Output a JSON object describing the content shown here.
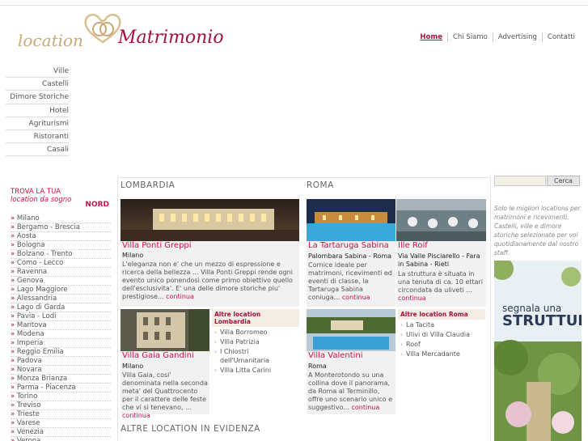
{
  "header": {
    "logo_word1": "location",
    "logo_word2": "Matrimonio",
    "nav": [
      "Home",
      "Chi Siamo",
      "Advertising",
      "Contatti"
    ]
  },
  "leftmenu": [
    "Ville",
    "Castelli",
    "Dimore Storiche",
    "Hotel",
    "Agriturismi",
    "Ristoranti",
    "Casali"
  ],
  "trova": {
    "line1": "TROVA LA TUA",
    "line2": "location da sogno",
    "area": "NORD"
  },
  "regions": [
    "Milano",
    "Bergamo - Brescia",
    "Aosta",
    "Bologna",
    "Bolzano - Trento",
    "Como - Lecco",
    "Ravenna",
    "Genova",
    "Lago Maggiore",
    "Alessandria",
    "Lago di Garda",
    "Pavia - Lodi",
    "Mantova",
    "Modena",
    "Imperia",
    "Reggio Emilia",
    "Padova",
    "Novara",
    "Monza Brianza",
    "Parma - Piacenza",
    "Torino",
    "Treviso",
    "Trieste",
    "Varese",
    "Venezia",
    "Verona"
  ],
  "region_prefix": "»",
  "sections": {
    "lombardia": "LOMBARDIA",
    "roma": "ROMA",
    "evidenza": "ALTRE LOCATION IN EVIDENZA"
  },
  "cards": {
    "ponti": {
      "title": "Villa Ponti Greppi",
      "city": "Milano",
      "desc": "L'eleganza non e' che un mezzo di espressione e ricerca della bellezza ... Villa Ponti Greppi rende ogni evento unico ponendosi come primo obiettivo quello dell'esclusivita'. E' una delle dimore storiche piu' prestigiose...",
      "more": "continua"
    },
    "tartaruga": {
      "title": "La Tartaruga Sabina",
      "city": "Palombara Sabina - Roma",
      "desc": "Cornice ideale per matrimoni, ricevimenti ed eventi di classe, la Tartaruga Sabina coniuga...",
      "more": "continua"
    },
    "roif": {
      "title": "Ille Roif",
      "city": "Via Valle Pisciarello - Fara in Sabina - Rieti",
      "desc": "La struttura è situata in una tenuta di ca. 10 ettari circondata da uliveti ...",
      "more": "continua"
    },
    "gaia": {
      "title": "Villa Gaia Gandini",
      "city": "Milano",
      "desc": "Villa Gaia, cosi' denominata nella seconda meta' del Quattrocento per il carattere delle feste che vi si tenevano, ...",
      "more": "continua"
    },
    "valentini": {
      "title": "Villa Valentini",
      "city": "Roma",
      "desc": "A Monterotondo su una collina dove il panorama, da Roma al Terminillo, offre uno scenario unico e suggestivo...",
      "more": "continua"
    }
  },
  "altre_lombardia": {
    "title": "Altre location Lombardia",
    "items": [
      "Villa Borromeo",
      "Villa Patrizia",
      "I Chiostri dell'Umanitaria",
      "Villa Litta Carini"
    ]
  },
  "altre_roma": {
    "title": "Altre location Roma",
    "items": [
      "La Tacita",
      "Ulivi di Villa Claudia",
      "Roof",
      "Villa Mercadante"
    ]
  },
  "right": {
    "search_button": "Cerca",
    "text": "Solo le migliori locations per matrimoni e ricevimenti. Castelli, ville e dimore storiche selezionate per voi quotidianamente dal nostro staff.",
    "banner_line1": "segnala una",
    "banner_line2": "STRUTTURA"
  }
}
